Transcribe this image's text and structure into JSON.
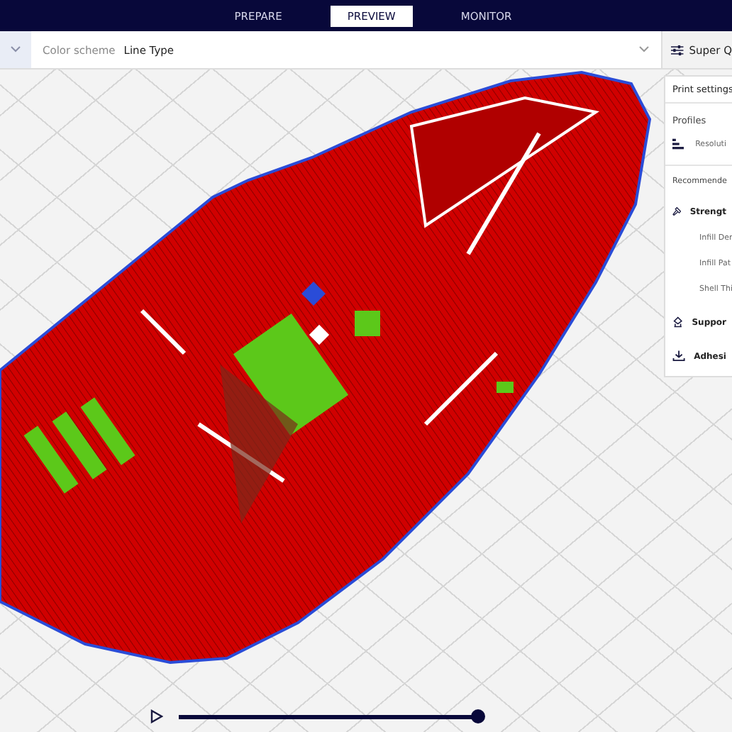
{
  "tabs": [
    {
      "label": "PREPARE",
      "selected": false
    },
    {
      "label": "PREVIEW",
      "selected": true
    },
    {
      "label": "MONITOR",
      "selected": false
    }
  ],
  "view_bar": {
    "label": "Color scheme",
    "value": "Line Type"
  },
  "profile_button": {
    "label": "Super Q"
  },
  "print_settings": {
    "title": "Print settings",
    "profiles_label": "Profiles",
    "profile_value": "Resoluti",
    "recommended_label": "Recommende",
    "sections": [
      {
        "kind": "strength",
        "label": "Strengt",
        "settings": [
          "Infill Der",
          "Infill Pat",
          "Shell Thi"
        ]
      },
      {
        "kind": "support",
        "label": "Suppor"
      },
      {
        "kind": "adhesion",
        "label": "Adhesi"
      }
    ]
  },
  "layer_slider": {
    "level": 1
  }
}
